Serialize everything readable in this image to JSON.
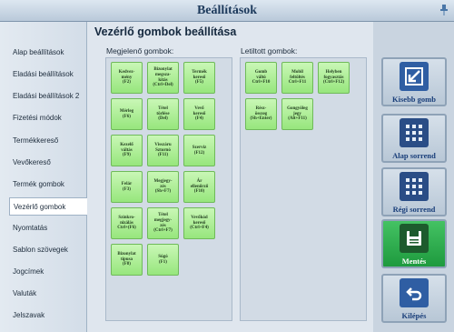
{
  "window": {
    "title": "Beállítások"
  },
  "sidebar": {
    "items": [
      {
        "label": "Alap beállítások"
      },
      {
        "label": "Eladási beállítások"
      },
      {
        "label": "Eladási beállítások 2"
      },
      {
        "label": "Fizetési módok"
      },
      {
        "label": "Termékkereső"
      },
      {
        "label": "Vevőkereső"
      },
      {
        "label": "Termék gombok"
      },
      {
        "label": "Vezérlő gombok"
      },
      {
        "label": "Nyomtatás"
      },
      {
        "label": "Sablon szövegek"
      },
      {
        "label": "Jogcímek"
      },
      {
        "label": "Valuták"
      },
      {
        "label": "Jelszavak"
      }
    ],
    "active_index": 7
  },
  "main": {
    "title": "Vezérlő gombok beállítása",
    "visible_label": "Megjelenő gombok:",
    "disabled_label": "Letiltott gombok:"
  },
  "visible_buttons": [
    "Kedvez-\nmény\n(F2)",
    "Bizonylat\nmegsza-\nkítás\n(Ctrl+Del)",
    "Termék\nkereső\n(F5)",
    "Mérleg\n(F6)",
    "Tétel\ntörlése\n(Del)",
    "Vevő\nkereső\n(F4)",
    "Kezelő\nváltás\n(F9)",
    "Visszáru\nSztornó\n(F11)",
    "Szerviz\n(F12)",
    "Felár\n(F3)",
    "Megjegy-\nzés\n(Sh+F7)",
    "Ár\nellenőrző\n(F10)",
    "Szinkro-\nnizálás\nCtrl+(F6)",
    "Tétel\nmegjegy-\nzés\n(Ctrl+F7)",
    "Vevőkód\nkereső\n(Ctrl+F4)",
    "Bizonylat\ntípusa\n(F8)",
    "Súgó\n(F1)"
  ],
  "disabled_buttons": [
    "Gomb\nváltó\nCtrl+F10",
    "Mobil\nfeltöltés\nCtrl+F11",
    "Helyben\nfogyasztás\n(Ctrl+F12)",
    "Rész-\nösszeg\n(Sh+Enter)",
    "Gongyöleg\njegy\n(Alt+F11)"
  ],
  "actions": {
    "smaller": {
      "label": "Kisebb gomb",
      "icon": "shrink-arrow-icon"
    },
    "default_order": {
      "label": "Alap sorrend",
      "icon": "grid-icon"
    },
    "previous_order": {
      "label": "Régi sorrend",
      "icon": "grid-icon"
    },
    "save": {
      "label": "Mentés",
      "icon": "save-disk-icon"
    },
    "exit": {
      "label": "Kilépés",
      "icon": "back-arrow-icon"
    }
  },
  "colors": {
    "green_button": "#97e67d",
    "save_green": "#1e9a3e",
    "icon_blue": "#2f5ea3"
  }
}
